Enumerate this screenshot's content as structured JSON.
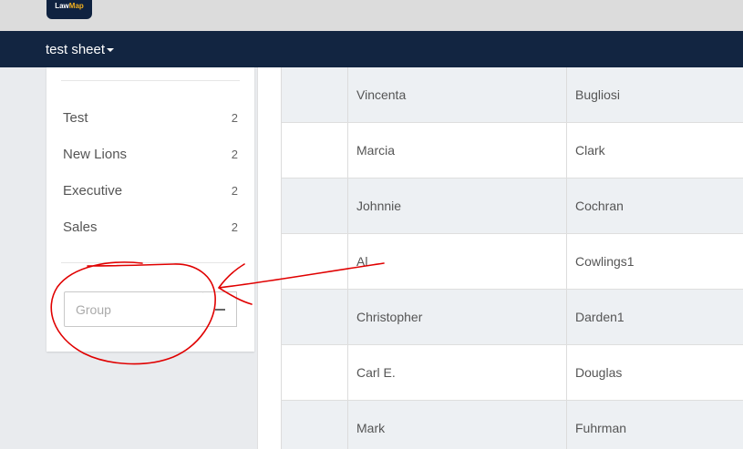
{
  "app": {
    "logo_text_1": "Law",
    "logo_text_2": "Map",
    "brand_color": "#122541",
    "accent_color": "#f2b01e"
  },
  "nav": {
    "sheet_label": "test sheet",
    "caret_icon": "caret-down-icon"
  },
  "sidebar": {
    "groups": [
      {
        "name": "Test",
        "count": "2"
      },
      {
        "name": "New Lions",
        "count": "2"
      },
      {
        "name": "Executive",
        "count": "2"
      },
      {
        "name": "Sales",
        "count": "2"
      }
    ],
    "group_input": {
      "placeholder": "Group",
      "value": ""
    },
    "remove_icon": "minus-icon"
  },
  "table": {
    "rows": [
      {
        "first": "Vincenta",
        "last": "Bugliosi"
      },
      {
        "first": "Marcia",
        "last": "Clark"
      },
      {
        "first": "Johnnie",
        "last": "Cochran"
      },
      {
        "first": "Al",
        "last": "Cowlings1"
      },
      {
        "first": "Christopher",
        "last": "Darden1"
      },
      {
        "first": "Carl E.",
        "last": "Douglas"
      },
      {
        "first": "Mark",
        "last": "Fuhrman"
      }
    ]
  },
  "annotation": {
    "color": "#e00000",
    "shape": "red hand-drawn circle around group input with arrow"
  }
}
